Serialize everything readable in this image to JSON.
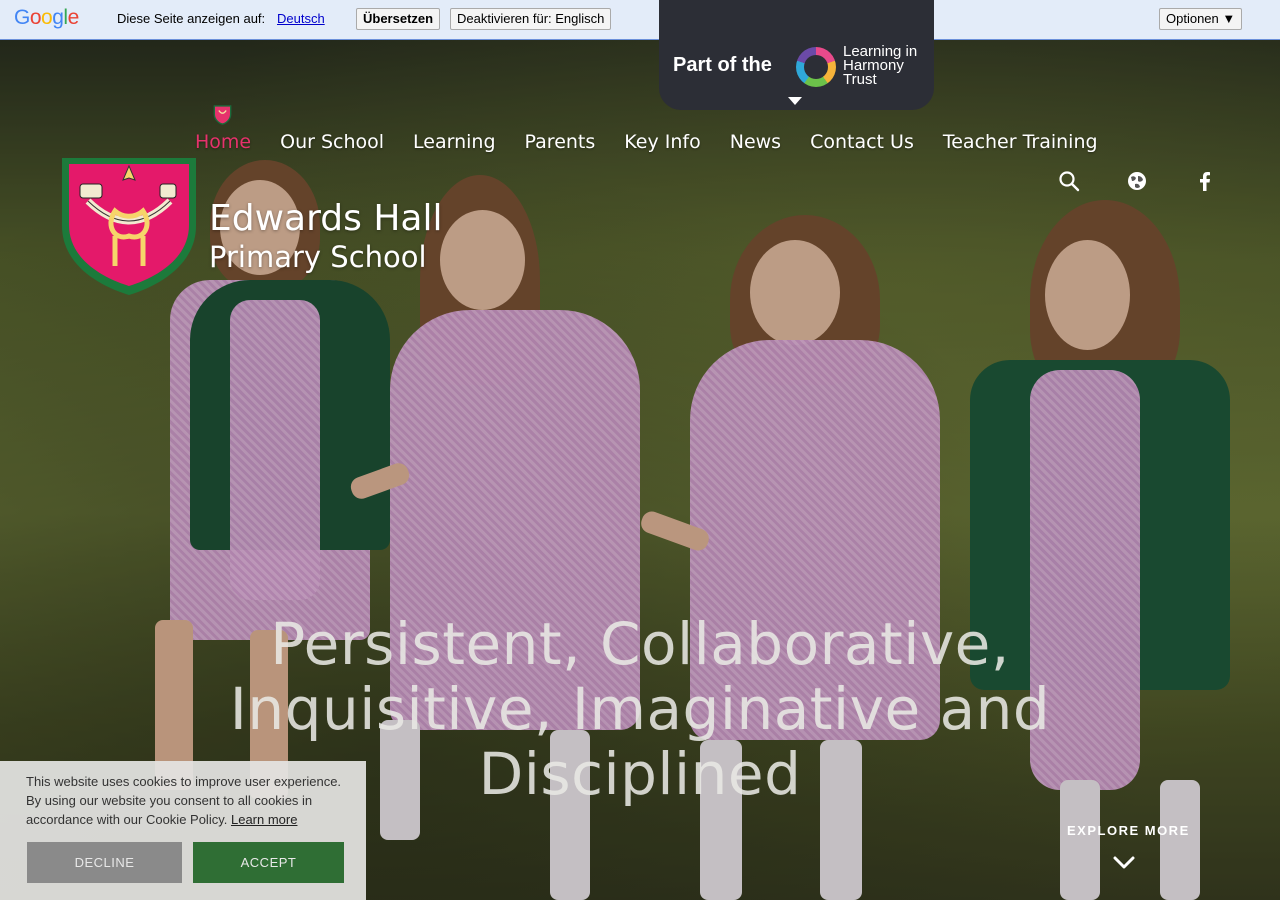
{
  "translate_bar": {
    "logo_text": "Google",
    "prompt": "Diese Seite anzeigen auf:",
    "language_link": "Deutsch",
    "translate_button": "Übersetzen",
    "disable_button": "Deaktivieren für: Englisch",
    "options_button": "Optionen ▼"
  },
  "trust_banner": {
    "part_of": "Part of the",
    "trust_name": "Learning in Harmony Trust"
  },
  "nav": {
    "items": [
      "Home",
      "Our School",
      "Learning",
      "Parents",
      "Key Info",
      "News",
      "Contact Us",
      "Teacher Training"
    ],
    "active": "Home"
  },
  "tools": {
    "search": "search-icon",
    "language": "globe-icon",
    "social": "facebook-icon"
  },
  "school": {
    "name": "Edwards Hall",
    "subtitle": "Primary School"
  },
  "hero": {
    "motto_line1": "Persistent, Collaborative,",
    "motto_line2": "Inquisitive, Imaginative and",
    "motto_line3": "Disciplined",
    "explore": "EXPLORE MORE"
  },
  "cookie_banner": {
    "text": "This website uses cookies to improve user experience. By using our website you consent to all cookies in accordance with our Cookie Policy.",
    "learn_more": "Learn more",
    "decline": "DECLINE",
    "accept": "ACCEPT"
  },
  "colors": {
    "accent_pink": "#e6326c",
    "accept_green": "#2f6e34",
    "trust_dark": "#2c2e36"
  }
}
